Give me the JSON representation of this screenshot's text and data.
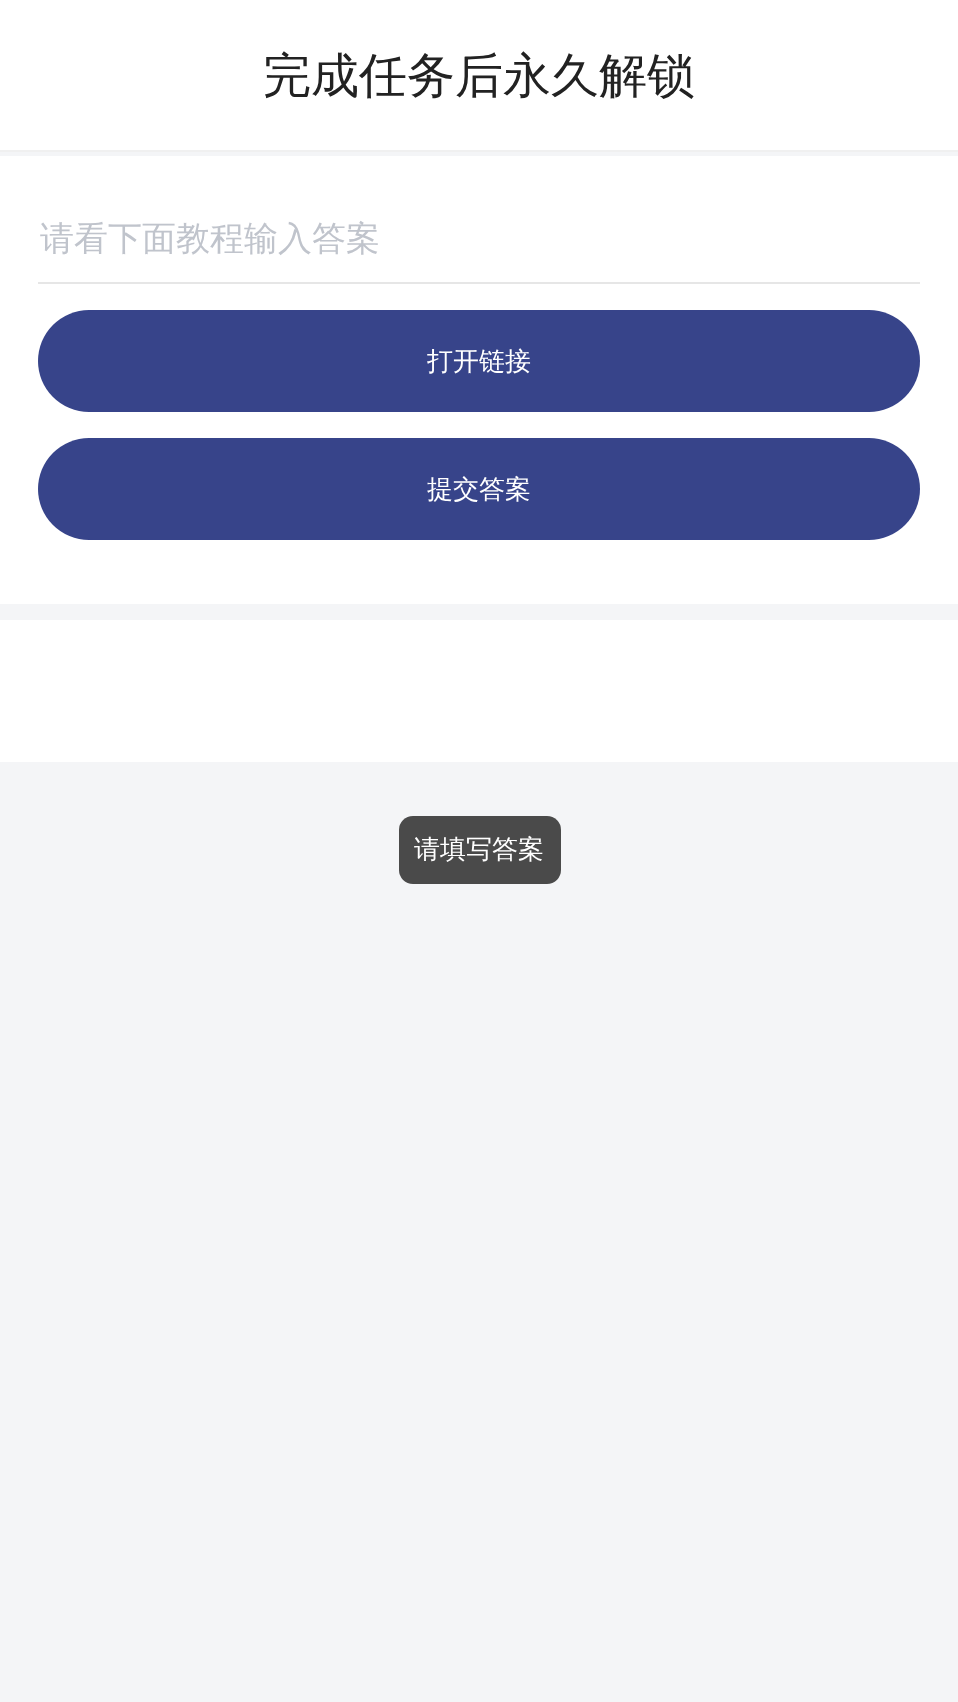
{
  "header": {
    "title": "完成任务后永久解锁"
  },
  "answer_field": {
    "placeholder": "请看下面教程输入答案"
  },
  "buttons": [
    "打开链接",
    "提交答案"
  ],
  "toast": {
    "message": "请填写答案"
  }
}
